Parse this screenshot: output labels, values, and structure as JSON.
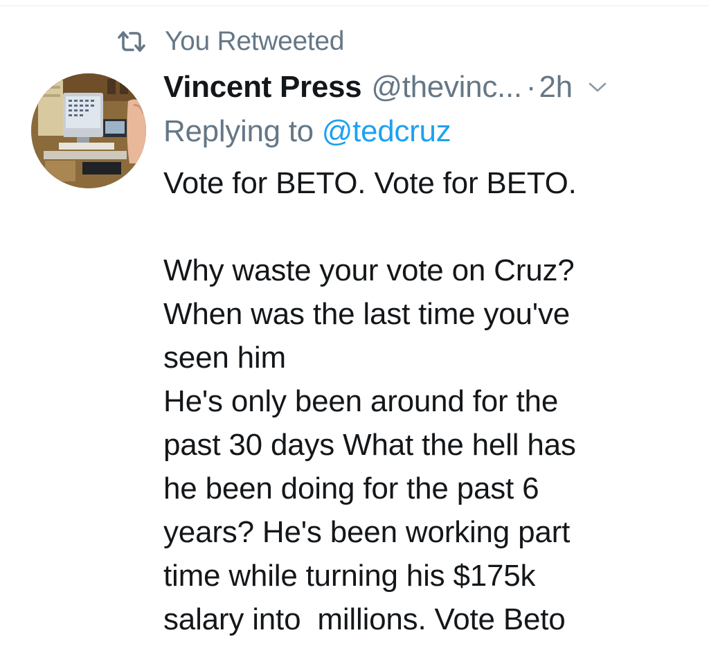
{
  "retweet_label": "You Retweeted",
  "author": {
    "display_name": "Vincent Press",
    "handle": "@thevinc...",
    "separator": "·",
    "time": "2h"
  },
  "reply": {
    "prefix": "Replying to",
    "mention": "@tedcruz"
  },
  "body_lines": [
    "Vote for BETO. Vote for BETO.",
    "",
    "Why waste your vote on Cruz?",
    "When was the last time you've",
    "seen him",
    "He's only been around for the",
    "past 30 days What the hell has",
    "he been doing for the past 6",
    "years? He's been working part",
    "time while turning his $175k",
    "salary into  millions. Vote Beto"
  ],
  "icons": {
    "retweet": "retweet-icon",
    "caret": "chevron-down-icon",
    "avatar": "avatar"
  },
  "colors": {
    "text_primary": "#14171a",
    "text_secondary": "#657786",
    "link": "#1da1f2"
  }
}
